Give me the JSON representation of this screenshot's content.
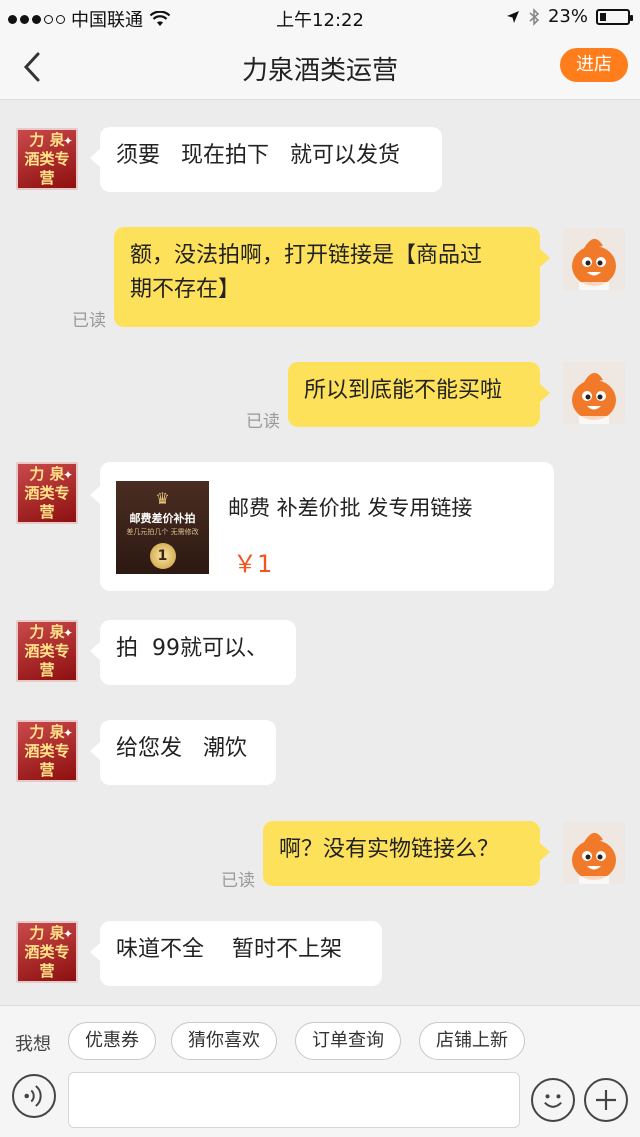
{
  "status_bar": {
    "carrier": "中国联通",
    "time": "上午12:22",
    "battery": "23%"
  },
  "nav": {
    "title": "力泉酒类运营",
    "enter_store": "进店"
  },
  "shop_avatar_text": {
    "line1": "力 泉",
    "line2": "酒类专营"
  },
  "messages": [
    {
      "text": "须要   现在拍下   就可以发货"
    },
    {
      "text_line1": "额，没法拍啊，打开链接是【商品过",
      "text_line2": "期不存在】",
      "read": "已读"
    },
    {
      "text": "所以到底能不能买啦",
      "read": "已读"
    },
    {
      "product_title": "邮费 补差价批 发专用链接",
      "price": "￥1",
      "thumb_title": "邮费差价补拍",
      "thumb_sub": "差几元拍几个 无需修改",
      "thumb_coin": "1"
    },
    {
      "text": "拍  99就可以、"
    },
    {
      "text": "给您发   潮饮"
    },
    {
      "text": "啊？没有实物链接么？",
      "read": "已读"
    },
    {
      "text": "味道不全    暂时不上架"
    }
  ],
  "quick_bar": {
    "label": "我想",
    "chips": [
      "优惠券",
      "猜你喜欢",
      "订单查询",
      "店铺上新"
    ]
  },
  "icons": {
    "back": "chevron-left-icon",
    "voice": "voice-icon",
    "emoji": "emoji-icon",
    "plus": "plus-icon",
    "wifi": "wifi-icon",
    "location": "location-icon",
    "bluetooth": "bluetooth-icon"
  },
  "colors": {
    "accent": "#ff7d1a",
    "bubble_out": "#fde15a",
    "price": "#f0561e"
  }
}
